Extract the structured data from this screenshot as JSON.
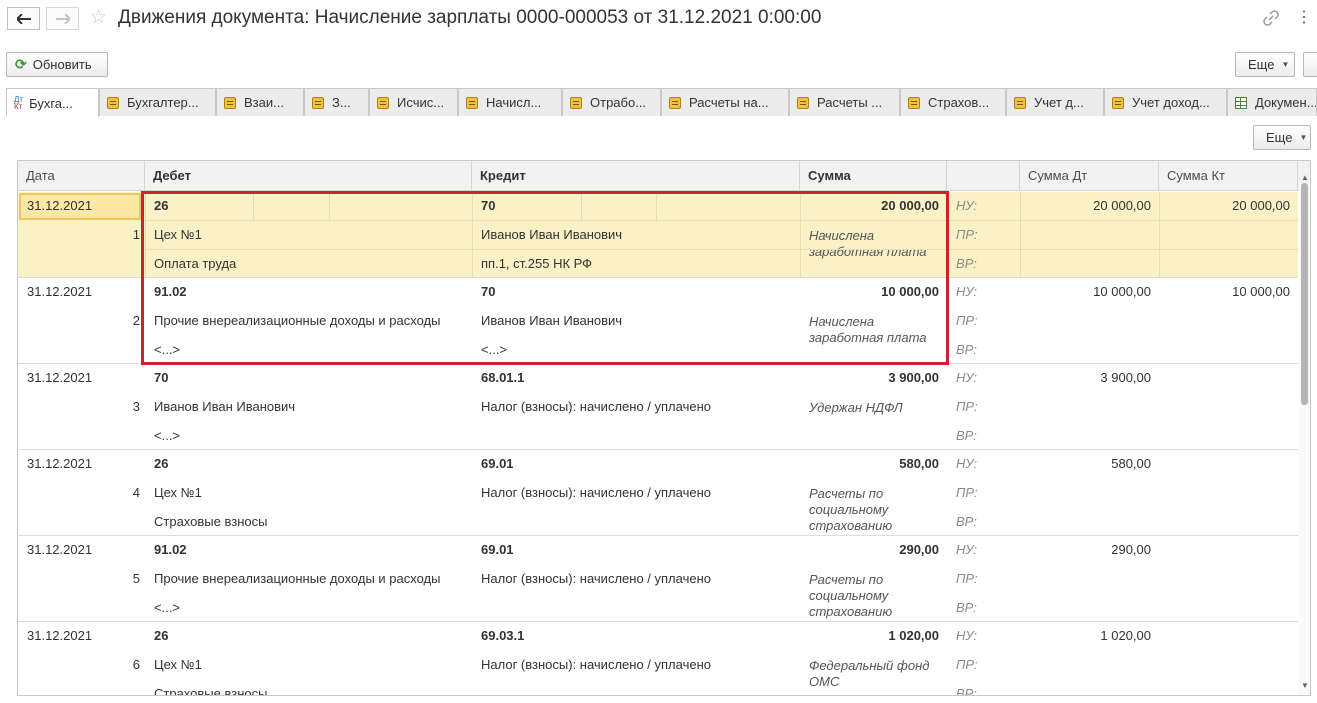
{
  "window": {
    "title": "Движения документа: Начисление зарплаты 0000-000053 от 31.12.2021 0:00:00"
  },
  "toolbar": {
    "refresh_label": "Обновить",
    "more_label": "Еще"
  },
  "tabs": [
    {
      "label": "Бухга...",
      "icon": "dt-kt-icon",
      "active": true
    },
    {
      "label": "Бухгалтер...",
      "icon": "register-icon"
    },
    {
      "label": "Взаи...",
      "icon": "register-icon"
    },
    {
      "label": "З...",
      "icon": "register-icon"
    },
    {
      "label": "Исчис...",
      "icon": "register-icon"
    },
    {
      "label": "Начисл...",
      "icon": "register-icon"
    },
    {
      "label": "Отрабо...",
      "icon": "register-icon"
    },
    {
      "label": "Расчеты на...",
      "icon": "register-icon"
    },
    {
      "label": "Расчеты ...",
      "icon": "register-icon"
    },
    {
      "label": "Страхов...",
      "icon": "register-icon"
    },
    {
      "label": "Учет д...",
      "icon": "register-icon"
    },
    {
      "label": "Учет доход...",
      "icon": "register-icon"
    },
    {
      "label": "Докумен...",
      "icon": "grid-icon"
    }
  ],
  "table": {
    "more_label": "Еще",
    "columns": [
      "Дата",
      "Дебет",
      "Кредит",
      "Сумма",
      "",
      "Сумма Дт",
      "Сумма Кт"
    ],
    "labels": {
      "nu": "НУ:",
      "pr": "ПР:",
      "vr": "ВР:"
    },
    "rows": [
      {
        "date": "31.12.2021",
        "num": "1",
        "debit_account": "26",
        "debit_sub1": "Цех №1",
        "debit_sub2": "Оплата труда",
        "credit_account": "70",
        "credit_sub1": "Иванов Иван Иванович",
        "credit_sub2": "пп.1, ст.255 НК РФ",
        "amount": "20 000,00",
        "content": "Начислена заработная плата",
        "sum_dt": "20 000,00",
        "sum_kt": "20 000,00"
      },
      {
        "date": "31.12.2021",
        "num": "2",
        "debit_account": "91.02",
        "debit_sub1": "Прочие внереализационные доходы и расходы",
        "debit_sub2": "<...>",
        "credit_account": "70",
        "credit_sub1": "Иванов Иван Иванович",
        "credit_sub2": "<...>",
        "amount": "10 000,00",
        "content": "Начислена заработная плата",
        "sum_dt": "10 000,00",
        "sum_kt": "10 000,00"
      },
      {
        "date": "31.12.2021",
        "num": "3",
        "debit_account": "70",
        "debit_sub1": "Иванов Иван Иванович",
        "debit_sub2": "<...>",
        "credit_account": "68.01.1",
        "credit_sub1": "Налог (взносы): начислено / уплачено",
        "credit_sub2": "",
        "amount": "3 900,00",
        "content": "Удержан НДФЛ",
        "sum_dt": "3 900,00",
        "sum_kt": ""
      },
      {
        "date": "31.12.2021",
        "num": "4",
        "debit_account": "26",
        "debit_sub1": "Цех №1",
        "debit_sub2": "Страховые взносы",
        "credit_account": "69.01",
        "credit_sub1": "Налог (взносы): начислено / уплачено",
        "credit_sub2": "",
        "amount": "580,00",
        "content": "Расчеты по социальному страхованию",
        "sum_dt": "580,00",
        "sum_kt": ""
      },
      {
        "date": "31.12.2021",
        "num": "5",
        "debit_account": "91.02",
        "debit_sub1": "Прочие внереализационные доходы и расходы",
        "debit_sub2": "<...>",
        "credit_account": "69.01",
        "credit_sub1": "Налог (взносы): начислено / уплачено",
        "credit_sub2": "",
        "amount": "290,00",
        "content": "Расчеты по социальному страхованию",
        "sum_dt": "290,00",
        "sum_kt": ""
      },
      {
        "date": "31.12.2021",
        "num": "6",
        "debit_account": "26",
        "debit_sub1": "Цех №1",
        "debit_sub2": "Страховые взносы",
        "credit_account": "69.03.1",
        "credit_sub1": "Налог (взносы): начислено / уплачено",
        "credit_sub2": "",
        "amount": "1 020,00",
        "content": "Федеральный фонд ОМС",
        "sum_dt": "1 020,00",
        "sum_kt": ""
      }
    ]
  },
  "colors": {
    "selected_row": "#fbf1c6",
    "highlight_box": "#d0202a",
    "accent_green": "#3b9a3b"
  }
}
